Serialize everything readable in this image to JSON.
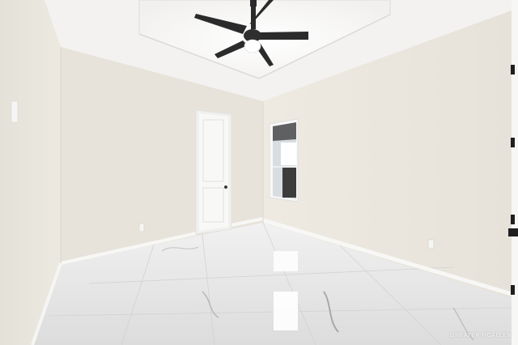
{
  "photo": {
    "watermark": "GREATER MCALLEN"
  },
  "colors": {
    "wall_left": "#ebe7df",
    "wall_back": "#e8e4dc",
    "wall_right": "#ece8e0",
    "ceiling": "#f4f3f1",
    "floor": "#e6e6e6",
    "fan": "#2b2b2b",
    "door": "#f6f6f6"
  }
}
